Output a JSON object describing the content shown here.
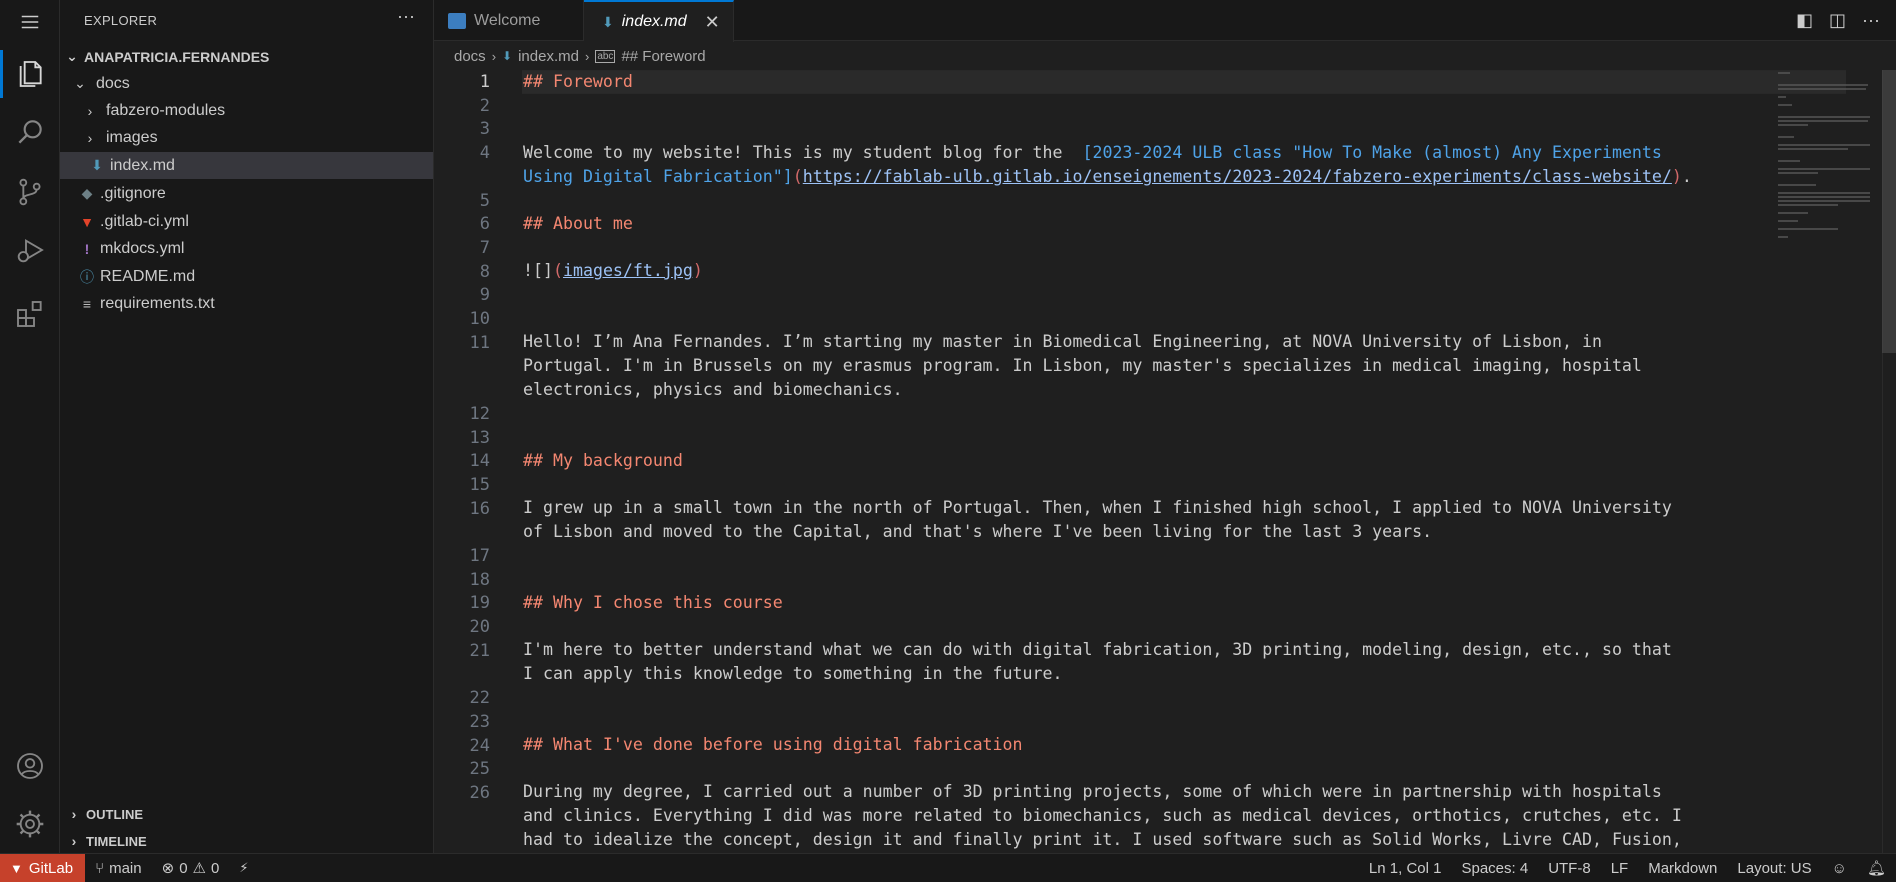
{
  "activity_bar": {
    "items": [
      "menu-icon",
      "explorer-icon",
      "search-icon",
      "source-control-icon",
      "run-debug-icon",
      "extensions-icon",
      "accounts-icon",
      "settings-gear-icon"
    ]
  },
  "sidebar": {
    "title": "EXPLORER",
    "more": "···",
    "root": "ANAPATRICIA.FERNANDES",
    "tree": [
      {
        "label": "docs",
        "type": "folder-open",
        "indent": 1
      },
      {
        "label": "fabzero-modules",
        "type": "folder",
        "indent": 2
      },
      {
        "label": "images",
        "type": "folder",
        "indent": 2
      },
      {
        "label": "index.md",
        "type": "markdown",
        "indent": 2,
        "selected": true
      },
      {
        "label": ".gitignore",
        "type": "git",
        "indent": 1
      },
      {
        "label": ".gitlab-ci.yml",
        "type": "gitlab",
        "indent": 1
      },
      {
        "label": "mkdocs.yml",
        "type": "yaml",
        "indent": 1
      },
      {
        "label": "README.md",
        "type": "info",
        "indent": 1
      },
      {
        "label": "requirements.txt",
        "type": "text",
        "indent": 1
      }
    ],
    "outline_label": "OUTLINE",
    "timeline_label": "TIMELINE"
  },
  "tabs": [
    {
      "label": "Welcome",
      "active": false
    },
    {
      "label": "index.md",
      "active": true
    }
  ],
  "tab_close": "✕",
  "breadcrumb": {
    "items": [
      "docs",
      "index.md",
      "## Foreword"
    ]
  },
  "editor": {
    "current_line": 1,
    "lines": [
      {
        "n": "1",
        "rows": 1
      },
      {
        "n": "2",
        "rows": 1
      },
      {
        "n": "3",
        "rows": 1
      },
      {
        "n": "4",
        "rows": 2
      },
      {
        "n": "5",
        "rows": 1
      },
      {
        "n": "6",
        "rows": 1
      },
      {
        "n": "7",
        "rows": 1
      },
      {
        "n": "8",
        "rows": 1
      },
      {
        "n": "9",
        "rows": 1
      },
      {
        "n": "10",
        "rows": 1
      },
      {
        "n": "11",
        "rows": 3
      },
      {
        "n": "12",
        "rows": 1
      },
      {
        "n": "13",
        "rows": 1
      },
      {
        "n": "14",
        "rows": 1
      },
      {
        "n": "15",
        "rows": 1
      },
      {
        "n": "16",
        "rows": 2
      },
      {
        "n": "17",
        "rows": 1
      },
      {
        "n": "18",
        "rows": 1
      },
      {
        "n": "19",
        "rows": 1
      },
      {
        "n": "20",
        "rows": 1
      },
      {
        "n": "21",
        "rows": 2
      },
      {
        "n": "22",
        "rows": 1
      },
      {
        "n": "23",
        "rows": 1
      },
      {
        "n": "24",
        "rows": 1
      },
      {
        "n": "25",
        "rows": 1
      },
      {
        "n": "26",
        "rows": 3
      }
    ],
    "text": {
      "l1": "## Foreword",
      "l4a_pre": "Welcome to my website! This is my student blog for the  ",
      "l4a_link": "[2023-2024 ULB class \"How To Make (almost) Any Experiments",
      "l4b_link": "Using Digital Fabrication\"]",
      "l4b_paren_open": "(",
      "l4b_url": "https://fablab-ulb.gitlab.io/enseignements/2023-2024/fabzero-experiments/class-website/",
      "l4b_paren_close": ")",
      "l4b_end": ".",
      "l6": "## About me",
      "l8_pre": "![]",
      "l8_paren_open": "(",
      "l8_url": "images/ft.jpg",
      "l8_paren_close": ")",
      "l11a": "Hello! I’m Ana Fernandes. I’m starting my master in Biomedical Engineering, at NOVA University of Lisbon, in",
      "l11b": "Portugal. I'm in Brussels on my erasmus program. In Lisbon, my master's specializes in medical imaging, hospital",
      "l11c": "electronics, physics and biomechanics.",
      "l14": "## My background",
      "l16a": "I grew up in a small town in the north of Portugal. Then, when I finished high school, I applied to NOVA University",
      "l16b": "of Lisbon and moved to the Capital, and that's where I've been living for the last 3 years.",
      "l19": "## Why I chose this course",
      "l21a": "I'm here to better understand what we can do with digital fabrication, 3D printing, modeling, design, etc., so that",
      "l21b": "I can apply this knowledge to something in the future.",
      "l24": "## What I've done before using digital fabrication",
      "l26a": "During my degree, I carried out a number of 3D printing projects, some of which were in partnership with hospitals",
      "l26b": "and clinics. Everything I did was more related to biomechanics, such as medical devices, orthotics, crutches, etc. I",
      "l26c": "had to idealize the concept, design it and finally print it. I used software such as Solid Works, Livre CAD, Fusion,"
    }
  },
  "status_bar": {
    "remote": "GitLab",
    "branch": "main",
    "errors": "0",
    "warnings": "0",
    "position": "Ln 1, Col 1",
    "spaces": "Spaces: 4",
    "encoding": "UTF-8",
    "eol": "LF",
    "language": "Markdown",
    "layout": "Layout: US"
  },
  "colors": {
    "accent": "#0078d4",
    "remote": "#c6412b",
    "heading": "#f48771",
    "link": "#4fa3e8"
  }
}
